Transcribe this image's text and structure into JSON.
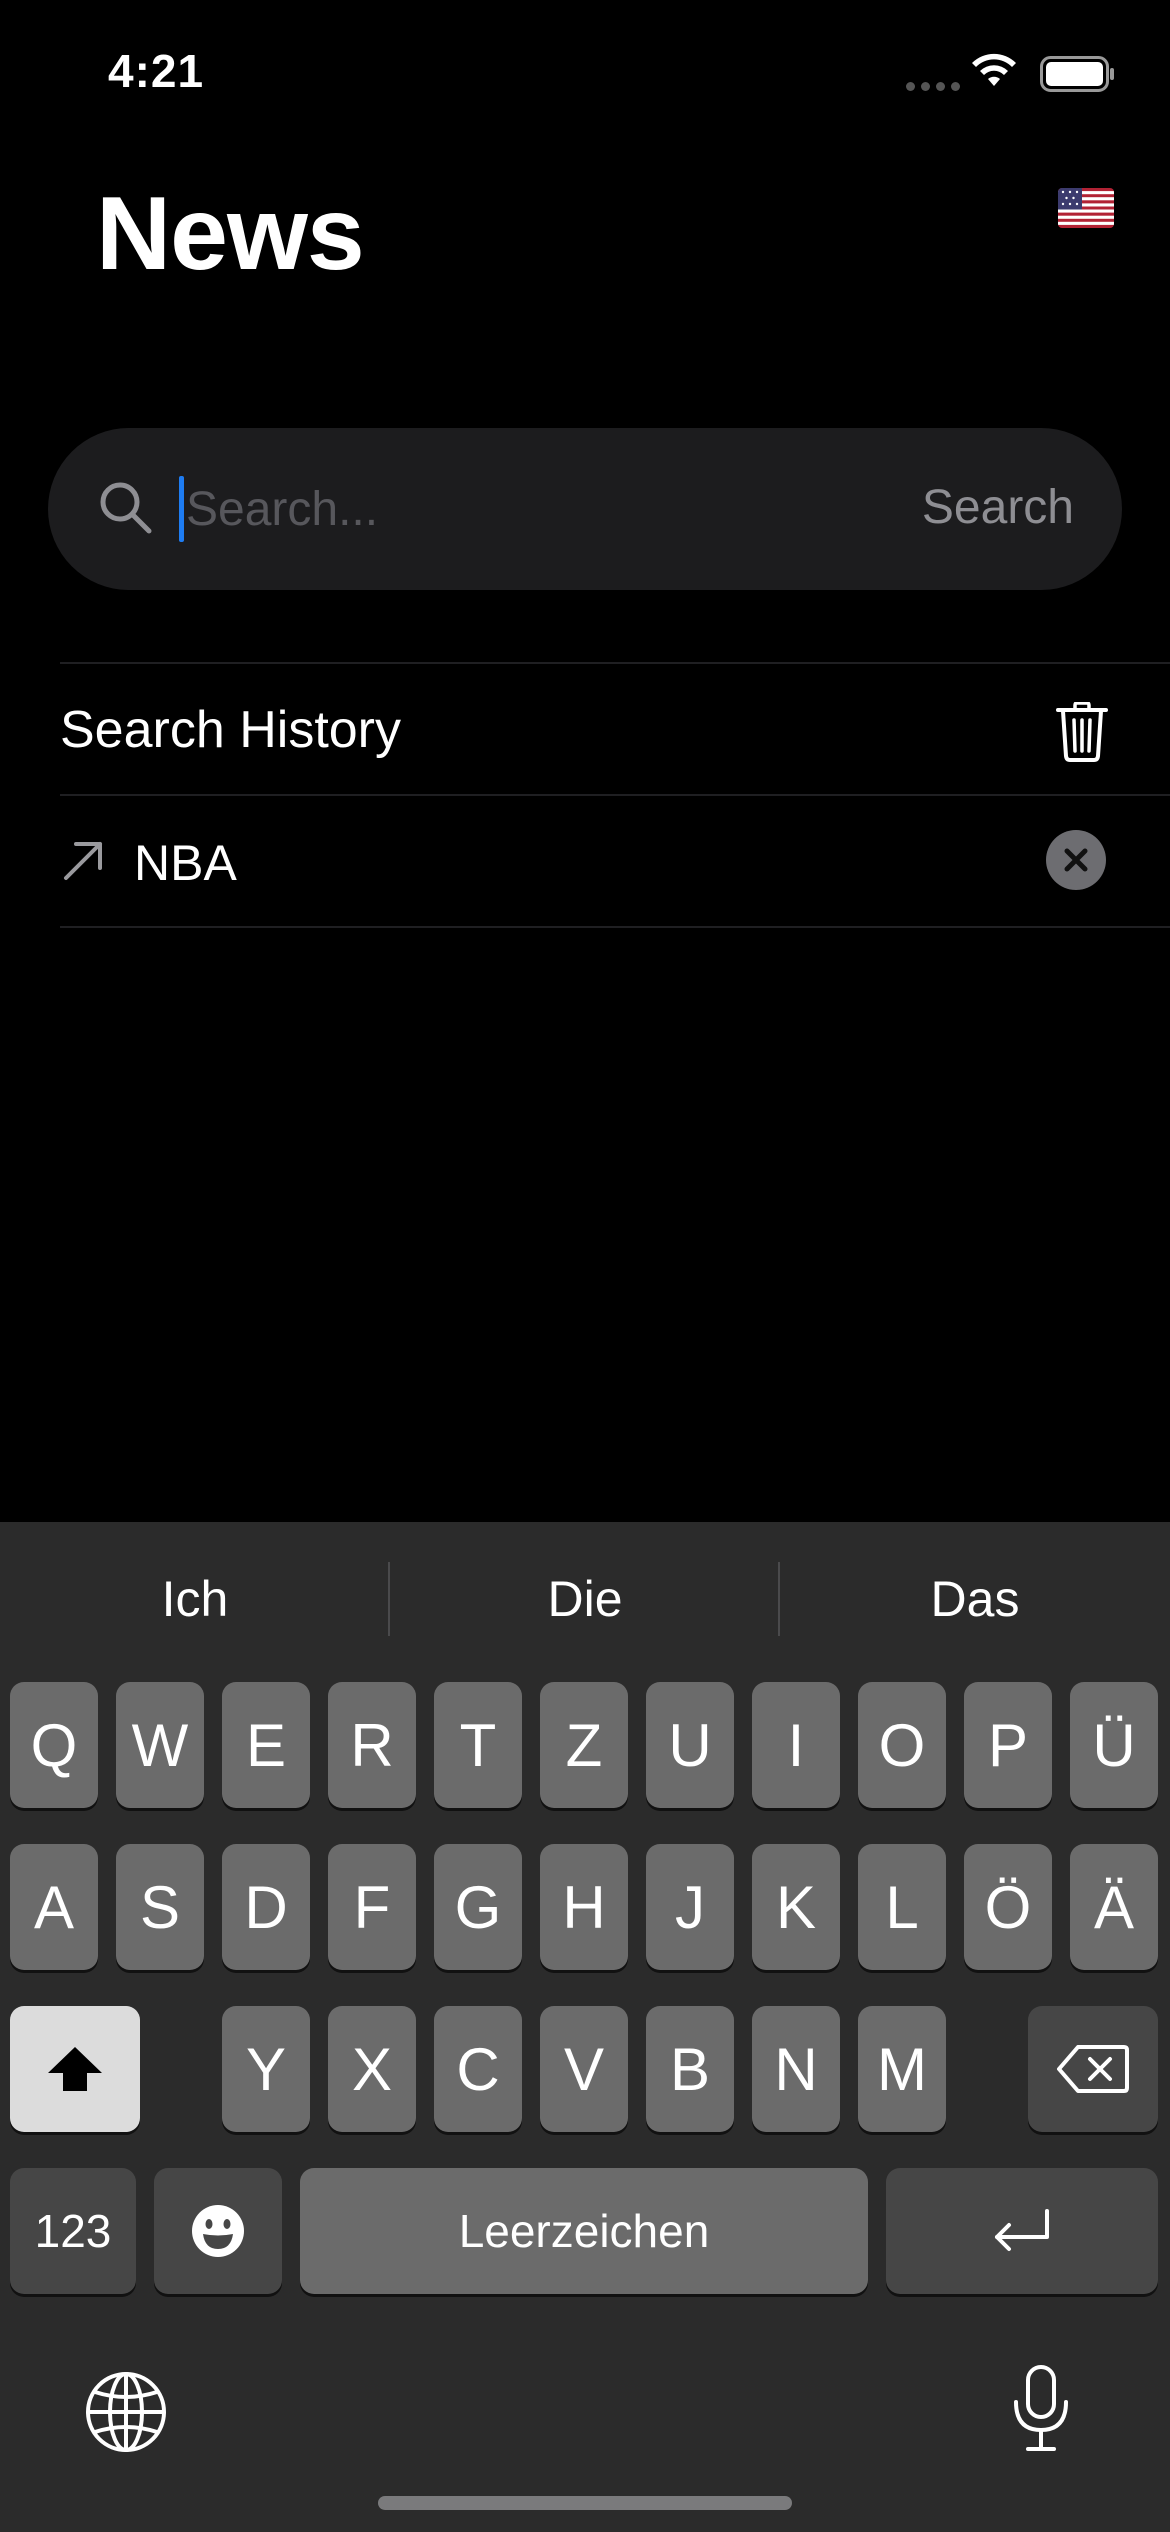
{
  "status_bar": {
    "time": "4:21"
  },
  "header": {
    "title": "News"
  },
  "search": {
    "placeholder": "Search...",
    "button_label": "Search"
  },
  "history": {
    "title": "Search History",
    "items": [
      {
        "label": "NBA"
      }
    ]
  },
  "keyboard": {
    "suggestions": [
      "Ich",
      "Die",
      "Das"
    ],
    "row1": [
      "Q",
      "W",
      "E",
      "R",
      "T",
      "Z",
      "U",
      "I",
      "O",
      "P",
      "Ü"
    ],
    "row2": [
      "A",
      "S",
      "D",
      "F",
      "G",
      "H",
      "J",
      "K",
      "L",
      "Ö",
      "Ä"
    ],
    "row3": [
      "Y",
      "X",
      "C",
      "V",
      "B",
      "N",
      "M"
    ],
    "numbers_label": "123",
    "space_label": "Leerzeichen"
  },
  "colors": {
    "accent": "#1e7cf2",
    "background": "#000000",
    "keyboard_bg": "#2b2b2b",
    "key": "#6b6b6b"
  },
  "icons": [
    "search-icon",
    "trash-icon",
    "arrow-up-right-icon",
    "remove-circle-icon",
    "shift-icon",
    "backspace-icon",
    "emoji-icon",
    "return-icon",
    "globe-icon",
    "microphone-icon",
    "wifi-icon",
    "battery-icon",
    "us-flag-icon"
  ]
}
